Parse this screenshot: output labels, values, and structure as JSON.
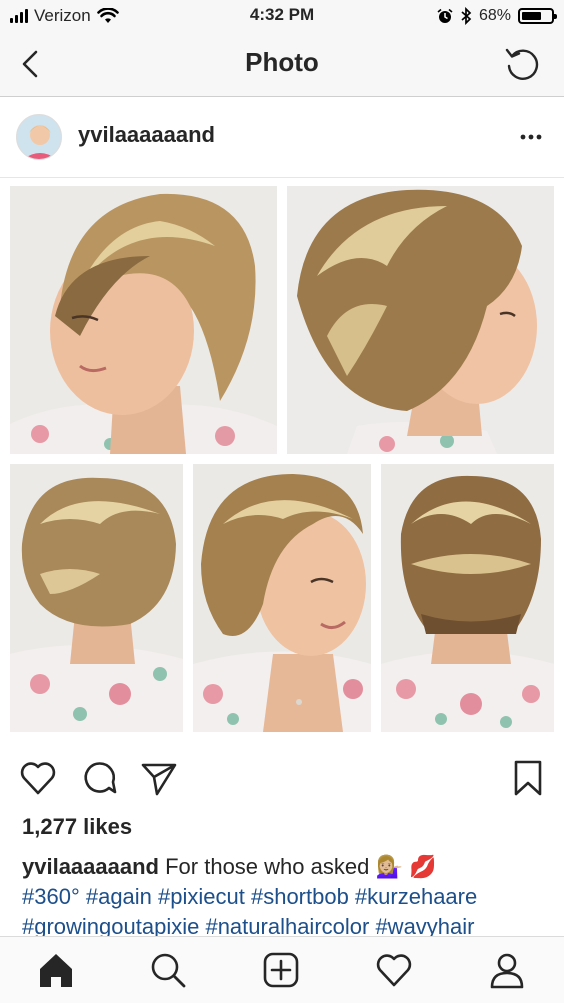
{
  "status_bar": {
    "carrier": "Verizon",
    "time": "4:32 PM",
    "battery": "68%",
    "battery_level": 0.68,
    "icons": [
      "signal-icon",
      "wifi-icon",
      "alarm-icon",
      "bluetooth-icon",
      "battery-icon"
    ]
  },
  "nav": {
    "title": "Photo",
    "back_icon": "chevron-left-icon",
    "refresh_icon": "refresh-icon"
  },
  "post": {
    "username": "yvilaaaaaand",
    "more_icon": "more-horizontal-icon",
    "photo_description_tiles": 5,
    "likes": "1,277 likes",
    "caption_user": "yvilaaaaaand",
    "caption_text": "For those who asked 💁🏼‍♀️ 💋",
    "hashtags_line1": "#360° #again #pixiecut #shortbob #kurzehaare",
    "hashtags_line2": "#growingoutapixie #naturalhaircolor #wavyhair"
  },
  "actions": {
    "icons": [
      "heart-icon",
      "comment-icon",
      "share-icon",
      "bookmark-icon"
    ]
  },
  "tabbar": {
    "icons": [
      "home-icon",
      "search-icon",
      "add-post-icon",
      "activity-heart-icon",
      "profile-icon"
    ]
  },
  "colors": {
    "hashtag": "#1d4f8a",
    "text": "#262626",
    "bar_bg": "#f7f7f7"
  }
}
